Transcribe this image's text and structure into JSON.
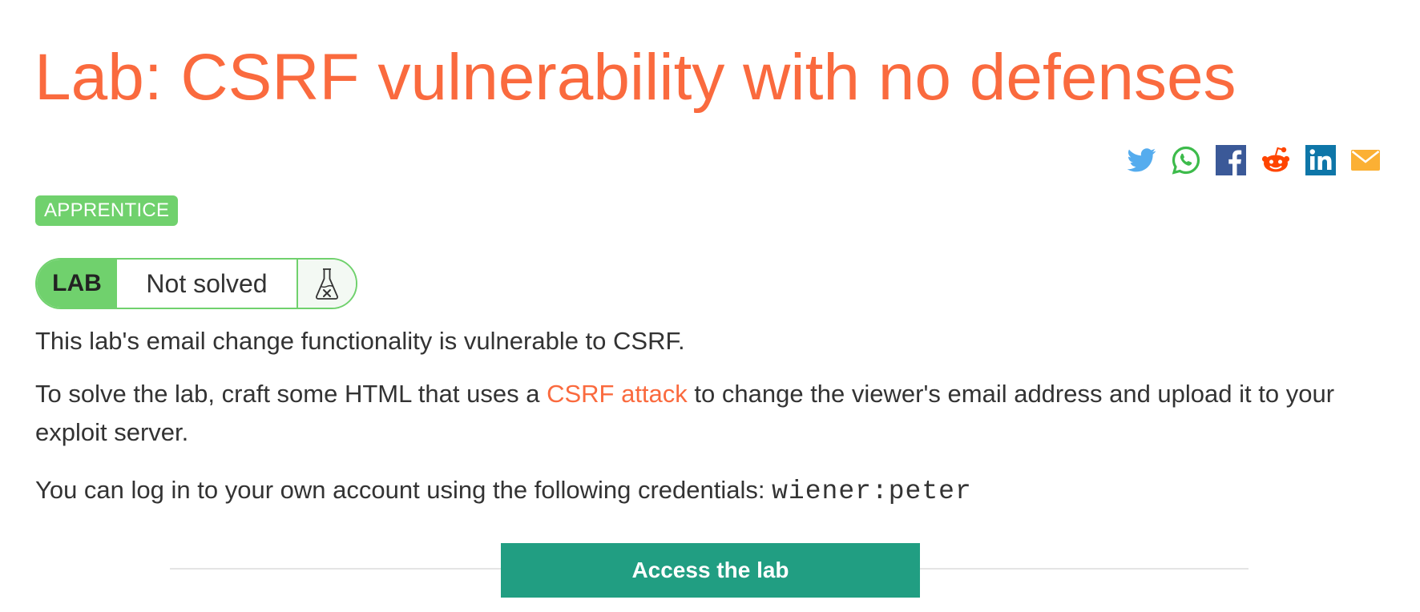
{
  "colors": {
    "accent": "#fa6a3e",
    "level_green": "#70d16d",
    "button_green": "#219e82",
    "text": "#333333"
  },
  "lab": {
    "title": "Lab: CSRF vulnerability with no defenses",
    "level": "APPRENTICE",
    "status_tag": "LAB",
    "status": "Not solved",
    "status_icon": "flask-icon"
  },
  "share": {
    "icons": [
      "twitter-icon",
      "whatsapp-icon",
      "facebook-icon",
      "reddit-icon",
      "linkedin-icon",
      "email-icon"
    ]
  },
  "description": {
    "p1": "This lab's email change functionality is vulnerable to CSRF.",
    "p2_before": "To solve the lab, craft some HTML that uses a ",
    "p2_link": "CSRF attack",
    "p2_after": " to change the viewer's email address and upload it to your exploit server.",
    "p3_before": "You can log in to your own account using the following credentials: ",
    "p3_credentials": "wiener:peter"
  },
  "action": {
    "button_label": "Access the lab"
  }
}
